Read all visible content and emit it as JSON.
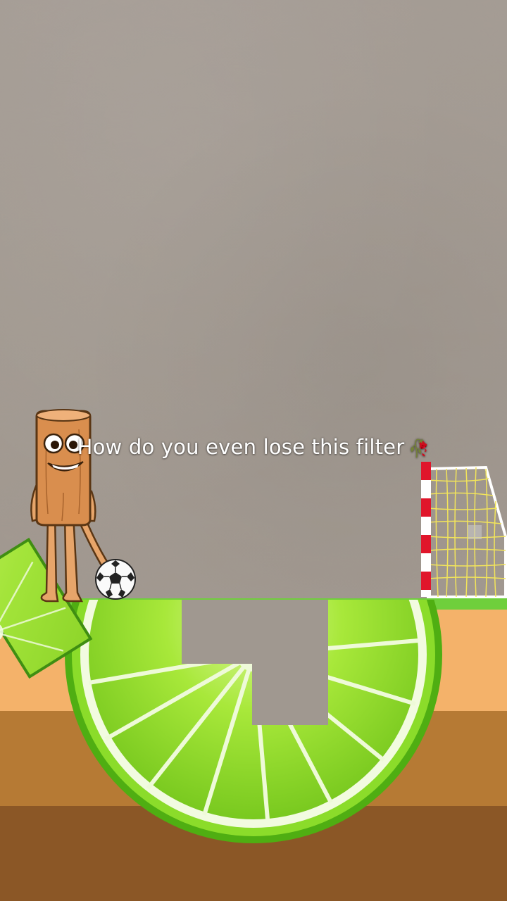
{
  "caption": {
    "text": "How do you even lose this filter",
    "emoji": "🥀"
  },
  "scene": {
    "character": "wooden-plank-mascot",
    "ball": "soccer-ball",
    "goal": "soccer-goal",
    "puzzle_piece": "lime-slice-block",
    "platform": "lime-slice-half"
  },
  "colors": {
    "wall": "#a39a92",
    "grass": "#6fcf3c",
    "sand": "#f4b26a",
    "soil": "#b67a34",
    "deep_soil": "#8b5726",
    "lime": "#7ed321",
    "goal_post_red": "#e0162b"
  }
}
